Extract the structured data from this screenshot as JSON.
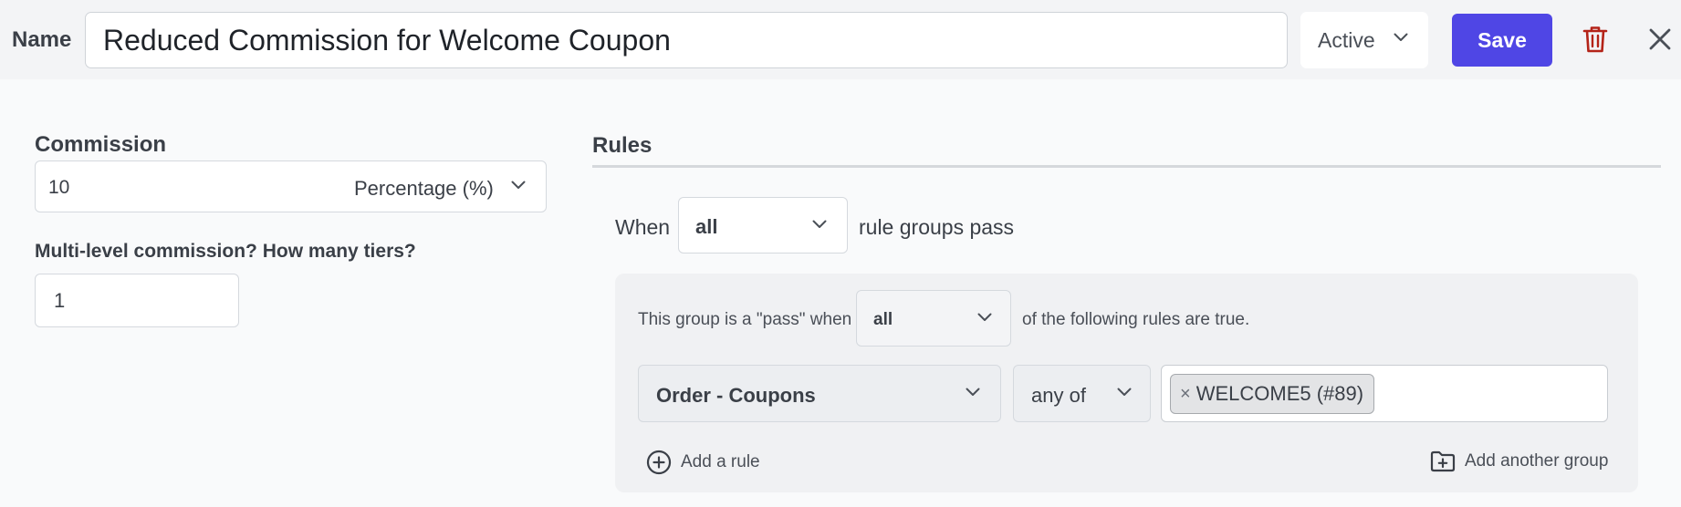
{
  "header": {
    "name_label": "Name",
    "name_value": "Reduced Commission for Welcome Coupon",
    "status": "Active",
    "save_label": "Save"
  },
  "commission": {
    "label": "Commission",
    "value": "10",
    "type": "Percentage (%)"
  },
  "tiers": {
    "label": "Multi-level commission? How many tiers?",
    "value": "1"
  },
  "rules": {
    "title": "Rules",
    "when_text": "When",
    "when_value": "all",
    "groups_pass_text": "rule groups pass",
    "group": {
      "prefix_text": "This group is a \"pass\" when",
      "match_value": "all",
      "suffix_text": "of the following rules are true.",
      "rule": {
        "field": "Order - Coupons",
        "operator": "any of",
        "tags": [
          "WELCOME5 (#89)"
        ]
      },
      "add_rule_label": "Add a rule",
      "add_group_label": "Add another group"
    }
  },
  "colors": {
    "accent": "#4f46e5",
    "danger": "#b42318",
    "background": "#f9fafb",
    "header_background": "#f3f4f6"
  },
  "icons": {
    "status_chevron": "chevron-down-icon",
    "delete": "trash-icon",
    "close": "close-icon",
    "add_rule": "plus-circle-icon",
    "add_group": "folder-plus-icon",
    "tag_remove": "x-icon"
  }
}
